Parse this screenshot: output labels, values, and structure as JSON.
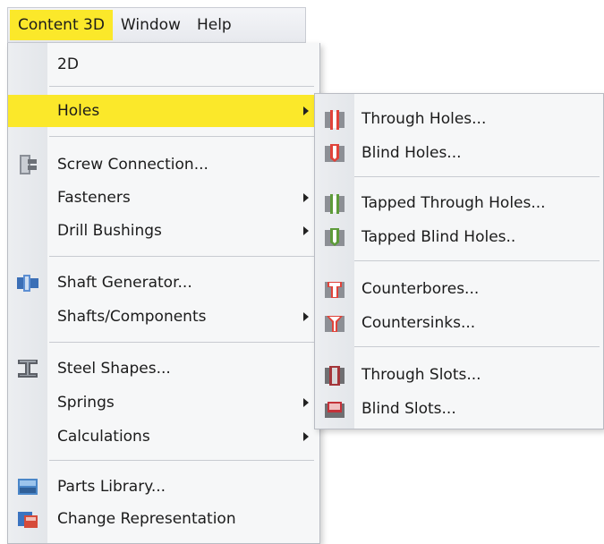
{
  "menubar": {
    "items": [
      {
        "label": "Content 3D",
        "active": true
      },
      {
        "label": "Window"
      },
      {
        "label": "Help"
      }
    ]
  },
  "menu": {
    "items": [
      {
        "label": "2D"
      },
      {
        "label": "Holes",
        "submenu": true,
        "highlighted": true,
        "icon": ""
      },
      {
        "label": "Screw Connection...",
        "icon": "screw-connection-icon"
      },
      {
        "label": "Fasteners",
        "submenu": true
      },
      {
        "label": "Drill Bushings",
        "submenu": true
      },
      {
        "label": "Shaft Generator...",
        "icon": "shaft-generator-icon"
      },
      {
        "label": "Shafts/Components",
        "submenu": true
      },
      {
        "label": "Steel Shapes...",
        "icon": "steel-shapes-icon"
      },
      {
        "label": "Springs",
        "submenu": true
      },
      {
        "label": "Calculations",
        "submenu": true
      },
      {
        "label": "Parts Library...",
        "icon": "parts-library-icon"
      },
      {
        "label": "Change Representation",
        "icon": "change-representation-icon"
      }
    ]
  },
  "submenu": {
    "items": [
      {
        "label": "Through Holes...",
        "icon": "through-holes-icon"
      },
      {
        "label": "Blind Holes...",
        "icon": "blind-holes-icon"
      },
      {
        "label": "Tapped Through Holes...",
        "icon": "tapped-through-holes-icon"
      },
      {
        "label": "Tapped Blind Holes..",
        "icon": "tapped-blind-holes-icon"
      },
      {
        "label": "Counterbores...",
        "icon": "counterbores-icon"
      },
      {
        "label": "Countersinks...",
        "icon": "countersinks-icon"
      },
      {
        "label": "Through Slots...",
        "icon": "through-slots-icon"
      },
      {
        "label": "Blind Slots...",
        "icon": "blind-slots-icon"
      }
    ]
  },
  "colors": {
    "highlight": "#fbe82a",
    "menu_bg": "#f6f7f8",
    "separator": "#c8cbd1"
  }
}
